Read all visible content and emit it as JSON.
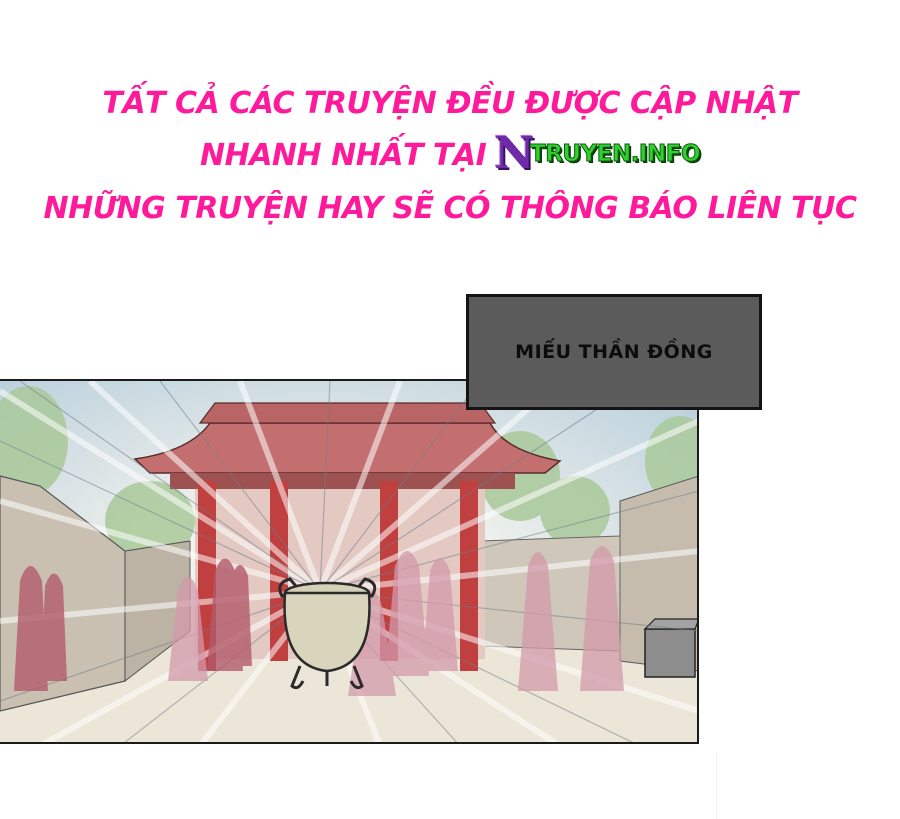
{
  "banner": {
    "line1": "Tất cả các truyện đều được cập nhật",
    "line2_prefix": "nhanh nhất tại",
    "logo_letter": "N",
    "logo_text": "TRUYEN.INFO",
    "line3": "Những truyện hay sẽ có thông báo liên tục"
  },
  "caption": {
    "text": "MIẾU THẦN ĐỒNG"
  },
  "colors": {
    "banner_text": "#ff1a9c",
    "logo_n": "#6f2aa8",
    "logo_text": "#2fd12f",
    "caption_bg": "#5b5b5b"
  }
}
